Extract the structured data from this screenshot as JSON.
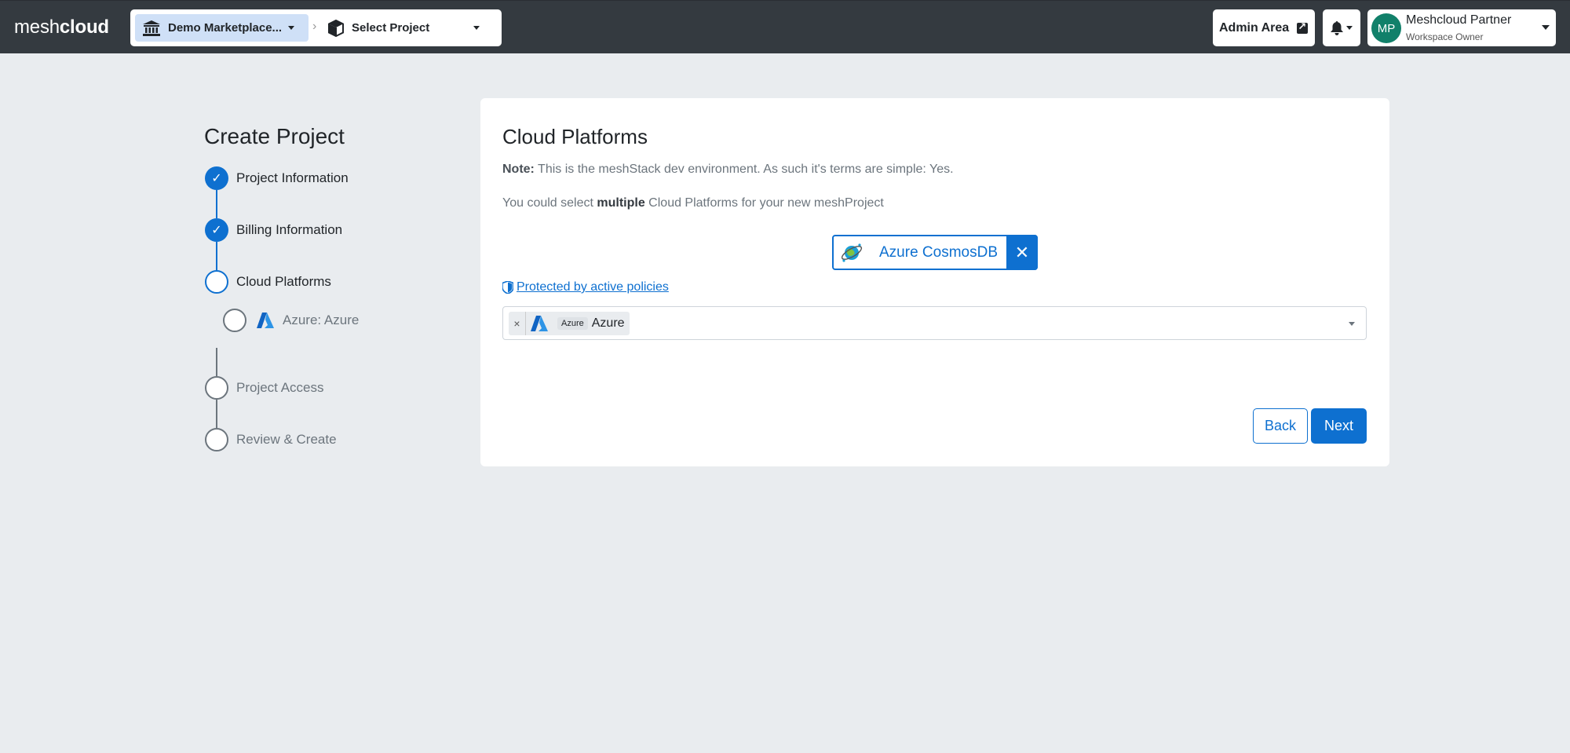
{
  "navbar": {
    "brand_part1": "mesh",
    "brand_part2": "cloud",
    "workspace_label": "Demo Marketplace...",
    "project_label": "Select Project",
    "admin_label": "Admin Area",
    "user_initials": "MP",
    "user_name": "Meshcloud Partner",
    "user_role": "Workspace Owner"
  },
  "stepper": {
    "title": "Create Project",
    "steps": [
      {
        "label": "Project Information",
        "state": "done"
      },
      {
        "label": "Billing Information",
        "state": "done"
      },
      {
        "label": "Cloud Platforms",
        "state": "active"
      },
      {
        "label": "Azure: Azure",
        "state": "sub"
      },
      {
        "label": "Project Access",
        "state": "todo"
      },
      {
        "label": "Review & Create",
        "state": "todo"
      }
    ],
    "check_glyph": "✓"
  },
  "card": {
    "title": "Cloud Platforms",
    "note_bold": "Note:",
    "note_text": " This is the meshStack dev environment. As such it's terms are simple: Yes.",
    "multi_pre": "You could select ",
    "multi_bold": "multiple",
    "multi_post": " Cloud Platforms for your new meshProject",
    "selected_platform": "Azure CosmosDB",
    "remove_glyph": "✕",
    "policy_link": "Protected by active policies",
    "select": {
      "tag_remove": "×",
      "tag_badge": "Azure",
      "tag_text": "Azure"
    },
    "back_label": "Back",
    "next_label": "Next"
  },
  "colors": {
    "primary": "#0e70d0",
    "navbar": "#343a40",
    "background": "#e9ecef",
    "avatar": "#11806a"
  },
  "icons": [
    "bank-icon",
    "cube-icon",
    "external-link-icon",
    "bell-icon",
    "check-icon",
    "azure-logo-icon",
    "cosmosdb-icon",
    "shield-icon",
    "chevron-down-icon"
  ]
}
